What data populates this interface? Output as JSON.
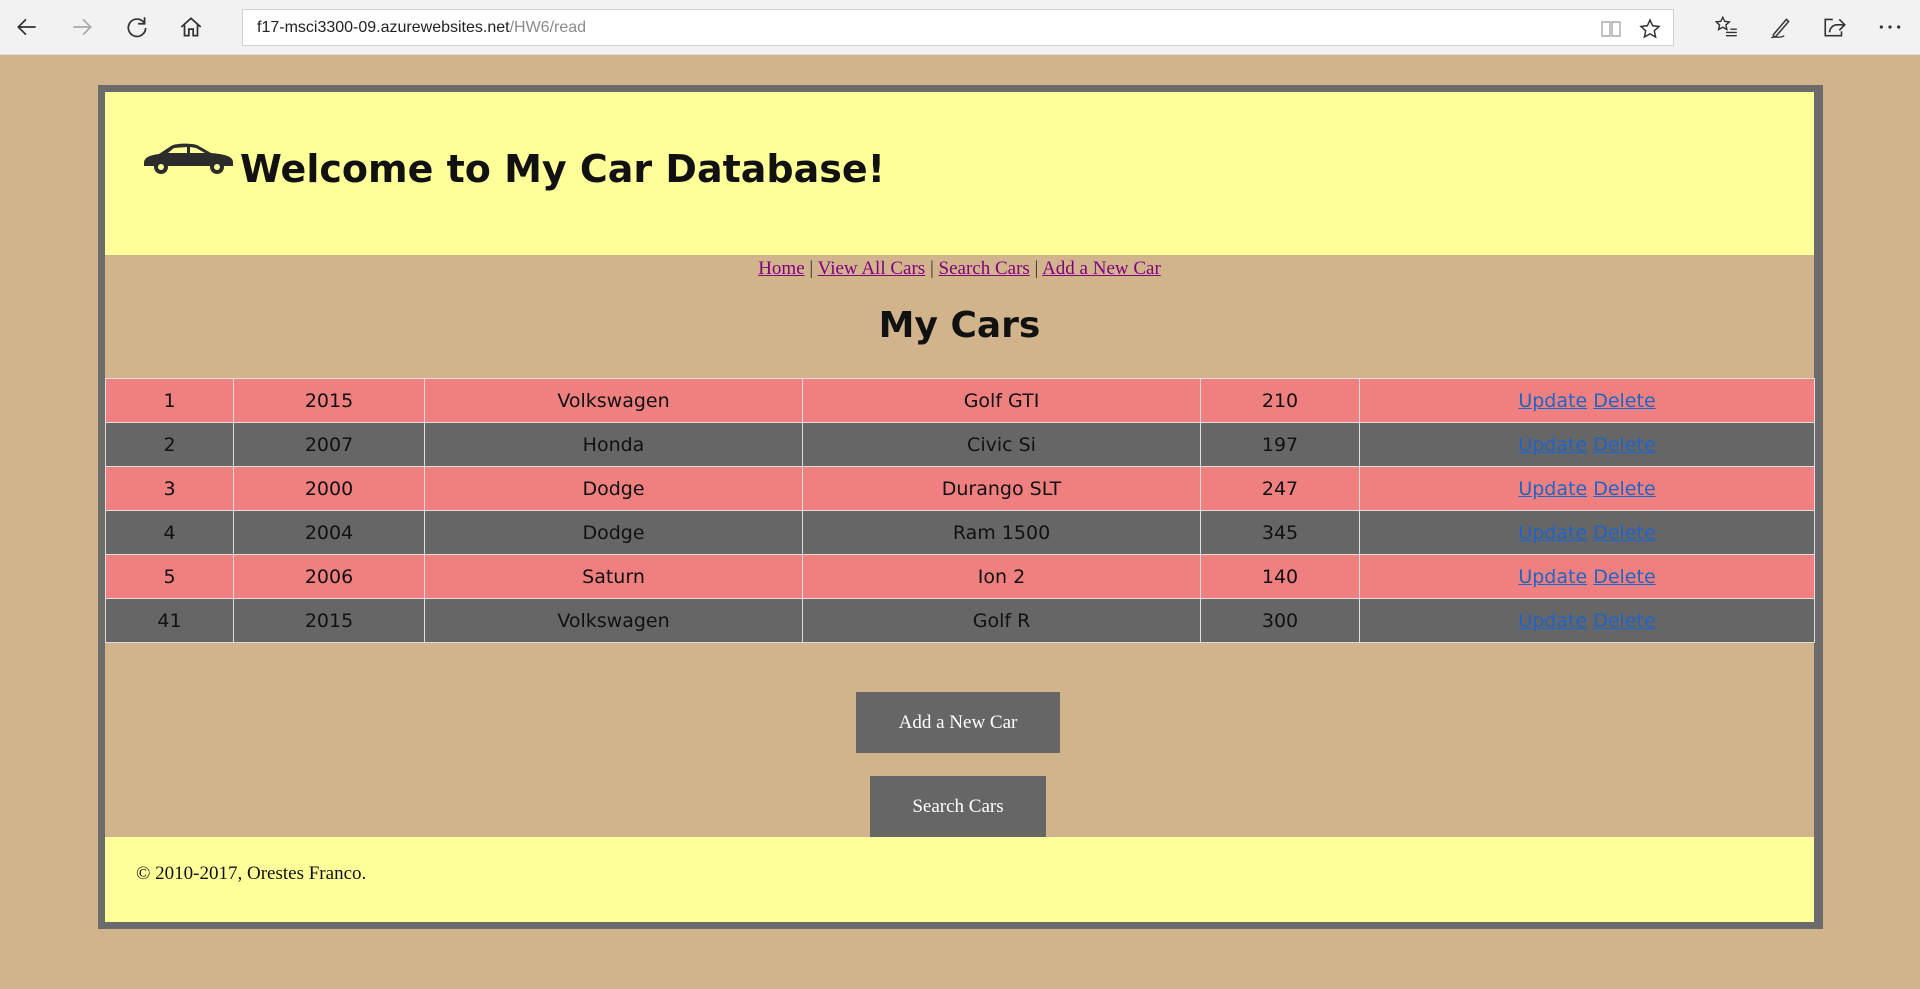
{
  "browser": {
    "url_host": "f17-msci3300-09.azurewebsites.net",
    "url_path": "/HW6/read"
  },
  "header": {
    "title": "Welcome to My Car Database!"
  },
  "nav": {
    "items": [
      "Home",
      "View All Cars",
      "Search Cars",
      "Add a New Car"
    ],
    "separator": "|"
  },
  "page_heading": "My Cars",
  "cars": [
    {
      "id": "1",
      "year": "2015",
      "make": "Volkswagen",
      "model": "Golf GTI",
      "hp": "210",
      "update": "Update",
      "delete": "Delete"
    },
    {
      "id": "2",
      "year": "2007",
      "make": "Honda",
      "model": "Civic Si",
      "hp": "197",
      "update": "Update",
      "delete": "Delete"
    },
    {
      "id": "3",
      "year": "2000",
      "make": "Dodge",
      "model": "Durango SLT",
      "hp": "247",
      "update": "Update",
      "delete": "Delete"
    },
    {
      "id": "4",
      "year": "2004",
      "make": "Dodge",
      "model": "Ram 1500",
      "hp": "345",
      "update": "Update",
      "delete": "Delete"
    },
    {
      "id": "5",
      "year": "2006",
      "make": "Saturn",
      "model": "Ion 2",
      "hp": "140",
      "update": "Update",
      "delete": "Delete"
    },
    {
      "id": "41",
      "year": "2015",
      "make": "Volkswagen",
      "model": "Golf R",
      "hp": "300",
      "update": "Update",
      "delete": "Delete"
    }
  ],
  "buttons": {
    "add": "Add a New Car",
    "search": "Search Cars"
  },
  "footer": {
    "copyright": "© 2010-2017, Orestes Franco."
  },
  "colors": {
    "page_bg": "#d2b48c",
    "header_bg": "#ffff99",
    "row_odd": "#f08080",
    "row_even": "#666666",
    "link": "#1e64c8",
    "nav_link": "#800080"
  },
  "icons": {
    "back": "back-arrow-icon",
    "forward": "forward-arrow-icon",
    "refresh": "refresh-icon",
    "home": "home-icon",
    "reading_view": "reading-view-icon",
    "favorite": "star-icon",
    "favorites_hub": "favorites-list-icon",
    "notes": "pen-icon",
    "share": "share-icon",
    "more": "more-icon",
    "logo": "car-icon"
  }
}
